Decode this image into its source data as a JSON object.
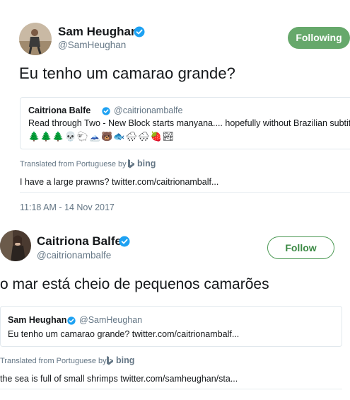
{
  "tweet1": {
    "author_name": "Sam Heughan",
    "author_handle": "@SamHeughan",
    "follow_button": "Following",
    "text": "Eu tenho um camarao grande?",
    "quote": {
      "author_name": "Caitriona Balfe",
      "author_handle": "@caitrionambalfe",
      "text": "Read through Two - New Block starts manyana.... hopefully without Brazilian subtit",
      "emojis": [
        "🌲",
        "🌲",
        "🌲",
        "💀",
        "🐑",
        "🗻",
        "🐻",
        "🐟",
        "🌧",
        "🌨",
        "🍓",
        "🏞"
      ]
    },
    "translated_from": "Translated from Portuguese by",
    "translator": "bing",
    "translation": "I have a large prawns? twitter.com/caitrionambalf...",
    "timestamp": "11:18 AM - 14 Nov 2017"
  },
  "tweet2": {
    "author_name": "Caitriona Balfe",
    "author_handle": "@caitrionambalfe",
    "follow_button": "Follow",
    "text": "o mar está cheio de pequenos camarões",
    "quote": {
      "author_name": "Sam Heughan",
      "author_handle": "@SamHeughan",
      "text": "Eu tenho um camarao grande? twitter.com/caitrionambalf..."
    },
    "translated_from": "Translated from Portuguese by",
    "translator": "bing",
    "translation": "the sea is full of small shrimps twitter.com/samheughan/sta..."
  },
  "colors": {
    "verified_blue": "#1da1f2",
    "following_green": "#66a86b",
    "follow_outline": "#4e9a56",
    "secondary_text": "#657786"
  }
}
